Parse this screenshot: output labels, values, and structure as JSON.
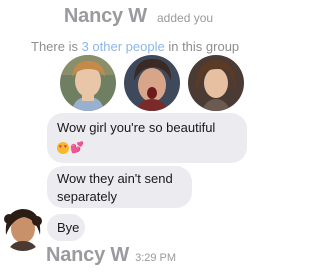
{
  "header": {
    "name": "Nancy W",
    "action": "added you"
  },
  "group_info": {
    "prefix": "There  is",
    "link": "3 other people",
    "suffix": "in this group"
  },
  "messages": [
    {
      "text": "Wow girl you're so beautiful",
      "emoji": [
        "smiling-face-with-heart-eyes",
        "two-hearts"
      ]
    },
    {
      "text": "Wow they ain't send separately"
    },
    {
      "text": "Bye"
    }
  ],
  "footer": {
    "name": "Nancy W",
    "time": "3:29 PM"
  },
  "colors": {
    "bubble": "#ebebf0",
    "link": "#8bb7e8",
    "gray_text": "#9a9a9f"
  }
}
